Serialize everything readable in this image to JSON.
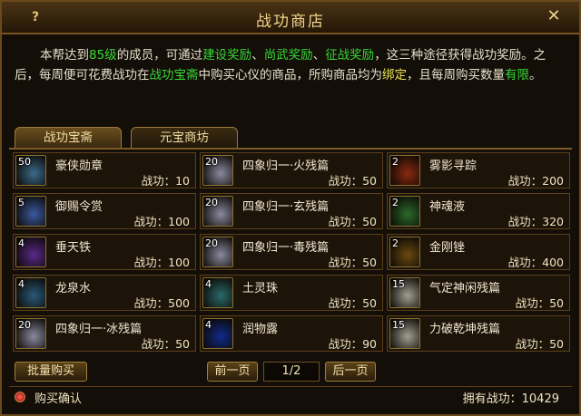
{
  "window": {
    "title": "战功商店",
    "help_label": "?",
    "close_label": "✕"
  },
  "description": {
    "t1": "本帮达到",
    "level": "85级",
    "t2": "的成员，可通过",
    "r1": "建设奖励",
    "sep1": "、",
    "r2": "尚武奖励",
    "sep2": "、",
    "r3": "征战奖励",
    "t3": "，这三种途径获得战功奖励。之后，每周便可花费战功在",
    "shop": "战功宝斋",
    "t4": "中购买心仪的商品，所购商品均为",
    "bound": "绑定",
    "t5": "，且每周购买数量",
    "limited": "有限",
    "t6": "。"
  },
  "tabs": [
    {
      "label": "战功宝斋",
      "active": true
    },
    {
      "label": "元宝商坊",
      "active": false
    }
  ],
  "items": [
    {
      "qty": "50",
      "name": "豪侠勋章",
      "price": "战功：10",
      "icon": "medal-icon",
      "color": "#3a6a8a"
    },
    {
      "qty": "20",
      "name": "四象归一·火残篇",
      "price": "战功：50",
      "icon": "scroll-icon",
      "color": "#8a8aa0"
    },
    {
      "qty": "2",
      "name": "雾影寻踪",
      "price": "战功：200",
      "icon": "compass-icon",
      "color": "#8a2a10"
    },
    {
      "qty": "5",
      "name": "御赐令赏",
      "price": "战功：100",
      "icon": "decree-icon",
      "color": "#3a5aa0"
    },
    {
      "qty": "20",
      "name": "四象归一·玄残篇",
      "price": "战功：50",
      "icon": "scroll-icon",
      "color": "#8a8aa0"
    },
    {
      "qty": "2",
      "name": "神魂液",
      "price": "战功：320",
      "icon": "potion-icon",
      "color": "#2a6a2a"
    },
    {
      "qty": "4",
      "name": "垂天铁",
      "price": "战功：100",
      "icon": "iron-icon",
      "color": "#5a2a8a"
    },
    {
      "qty": "20",
      "name": "四象归一·毒残篇",
      "price": "战功：50",
      "icon": "scroll-icon",
      "color": "#8a8aa0"
    },
    {
      "qty": "2",
      "name": "金刚锉",
      "price": "战功：400",
      "icon": "file-tool-icon",
      "color": "#6a4a10"
    },
    {
      "qty": "4",
      "name": "龙泉水",
      "price": "战功：500",
      "icon": "water-bowl-icon",
      "color": "#2a5a7a"
    },
    {
      "qty": "4",
      "name": "土灵珠",
      "price": "战功：50",
      "icon": "pearl-icon",
      "color": "#2a6a6a"
    },
    {
      "qty": "15",
      "name": "气定神闲残篇",
      "price": "战功：50",
      "icon": "scroll-icon",
      "color": "#a0a090"
    },
    {
      "qty": "20",
      "name": "四象归一·冰残篇",
      "price": "战功：50",
      "icon": "scroll-icon",
      "color": "#8a8aa0"
    },
    {
      "qty": "4",
      "name": "润物露",
      "price": "战功：90",
      "icon": "blue-flame-icon",
      "color": "#102a8a"
    },
    {
      "qty": "15",
      "name": "力破乾坤残篇",
      "price": "战功：50",
      "icon": "scroll-icon",
      "color": "#a0a090"
    }
  ],
  "footer": {
    "bulk_buy": "批量购买",
    "prev_page": "前一页",
    "page": "1/2",
    "next_page": "后一页",
    "confirm_label": "购买确认",
    "owned": "拥有战功：10429"
  }
}
